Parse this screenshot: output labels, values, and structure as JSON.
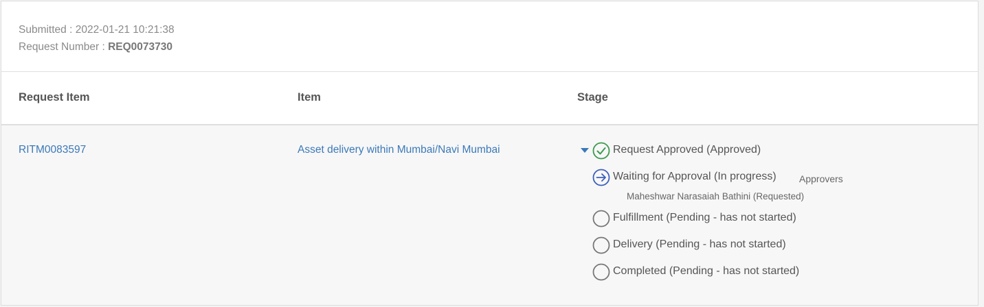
{
  "meta": {
    "submitted_label": "Submitted : ",
    "submitted_value": "2022-01-21 10:21:38",
    "request_number_label": "Request Number : ",
    "request_number_value": "REQ0073730"
  },
  "table": {
    "headers": {
      "request_item": "Request Item",
      "item": "Item",
      "stage": "Stage"
    },
    "row": {
      "request_item": "RITM0083597",
      "item": "Asset delivery within Mumbai/Navi Mumbai"
    }
  },
  "stages": [
    {
      "label": "Request Approved (Approved)",
      "status": "approved",
      "icon": "check-circle-icon"
    },
    {
      "label": "Waiting for Approval (In progress)",
      "status": "in-progress",
      "icon": "arrow-circle-icon"
    },
    {
      "label": "Fulfillment (Pending - has not started)",
      "status": "pending",
      "icon": "empty-circle-icon"
    },
    {
      "label": "Delivery (Pending - has not started)",
      "status": "pending",
      "icon": "empty-circle-icon"
    },
    {
      "label": "Completed (Pending - has not started)",
      "status": "pending",
      "icon": "empty-circle-icon"
    }
  ],
  "approvers": {
    "label": "Approvers",
    "entry": "Maheshwar Narasaiah Bathini (Requested)"
  },
  "colors": {
    "link": "#3b79b8",
    "approved": "#3c9a4e",
    "in_progress": "#3b5fc0",
    "pending": "#777777"
  }
}
